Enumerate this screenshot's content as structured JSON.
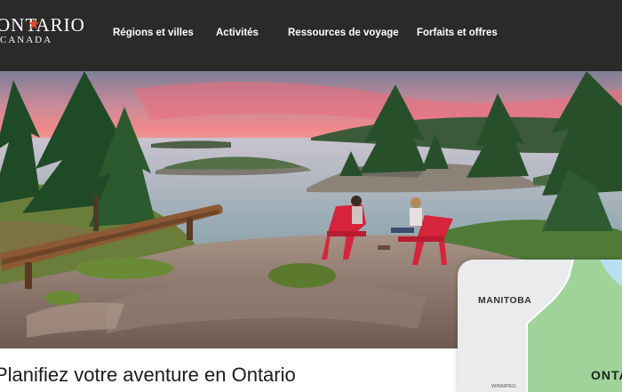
{
  "brand": {
    "name": "ONTARIO",
    "subtitle": "CANADA"
  },
  "nav": {
    "items": [
      {
        "label": "Régions et villes"
      },
      {
        "label": "Activités"
      },
      {
        "label": "Ressources de voyage"
      },
      {
        "label": "Forfaits et offres"
      }
    ]
  },
  "main": {
    "title": "Planifiez votre aventure en Ontario"
  },
  "map": {
    "province_left": "MANITOBA",
    "province_right": "ONTARIO",
    "city": "WINNIPEG"
  },
  "colors": {
    "header_bg": "#2a2a2a",
    "ontario_fill": "#9fd39a",
    "chair_red": "#d6243a"
  }
}
